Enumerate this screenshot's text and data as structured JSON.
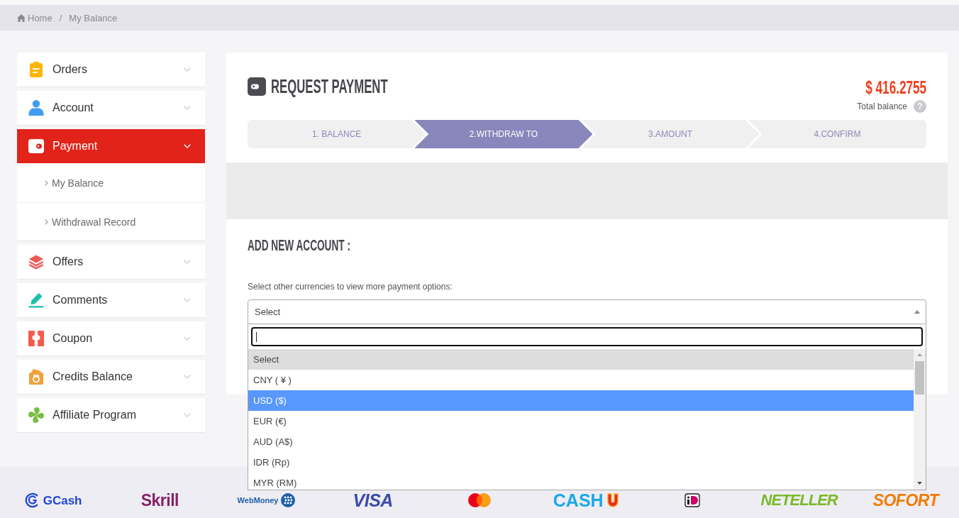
{
  "breadcrumb": {
    "items": [
      {
        "label": "Home"
      },
      {
        "label": "My Balance"
      }
    ],
    "separator": "/"
  },
  "sidebar": {
    "items": [
      {
        "label": "Orders",
        "selected": false
      },
      {
        "label": "Account",
        "selected": false
      },
      {
        "label": "Payment",
        "selected": true,
        "children": [
          {
            "label": "My Balance"
          },
          {
            "label": "Withdrawal Record"
          }
        ]
      },
      {
        "label": "Offers",
        "selected": false
      },
      {
        "label": "Comments",
        "selected": false
      },
      {
        "label": "Coupon",
        "selected": false
      },
      {
        "label": "Credits Balance",
        "selected": false
      },
      {
        "label": "Affiliate Program",
        "selected": false
      }
    ]
  },
  "panel": {
    "title": "REQUEST PAYMENT",
    "balance": "$ 416.2755",
    "balance_label": "Total balance",
    "help_mark": "?",
    "steps": [
      {
        "label": "1. BALANCE",
        "selected": false
      },
      {
        "label": "2.WITHDRAW TO",
        "selected": true
      },
      {
        "label": "3.AMOUNT",
        "selected": false
      },
      {
        "label": "4.CONFIRM",
        "selected": false
      }
    ],
    "section_title": "ADD NEW ACCOUNT :",
    "hint": "Select other currencies to view more payment options:",
    "currency_select": {
      "value": "Select",
      "open": true,
      "search": {
        "focused": true
      },
      "options": [
        {
          "label": "Select",
          "selected": true,
          "highlighted": false
        },
        {
          "label": "CNY ( ¥ )",
          "selected": false,
          "highlighted": false
        },
        {
          "label": "USD ($)",
          "selected": false,
          "highlighted": true
        },
        {
          "label": "EUR (€)",
          "selected": false,
          "highlighted": false
        },
        {
          "label": "AUD (A$)",
          "selected": false,
          "highlighted": false
        },
        {
          "label": "IDR (Rp)",
          "selected": false,
          "highlighted": false
        },
        {
          "label": "MYR (RM)",
          "selected": false,
          "highlighted": false
        }
      ]
    }
  },
  "footer": {
    "logos": [
      {
        "kind": "gcash",
        "text": "GCash"
      },
      {
        "kind": "skrill",
        "text": "Skrill"
      },
      {
        "kind": "webmoney",
        "text": "WebMoney"
      },
      {
        "kind": "visa",
        "text": "VISA"
      },
      {
        "kind": "mastercard"
      },
      {
        "kind": "cashu",
        "text": "CASH"
      },
      {
        "kind": "ideal"
      },
      {
        "kind": "neteller",
        "text": "NETELLER"
      },
      {
        "kind": "sofort",
        "text": "SOFORT"
      }
    ]
  }
}
